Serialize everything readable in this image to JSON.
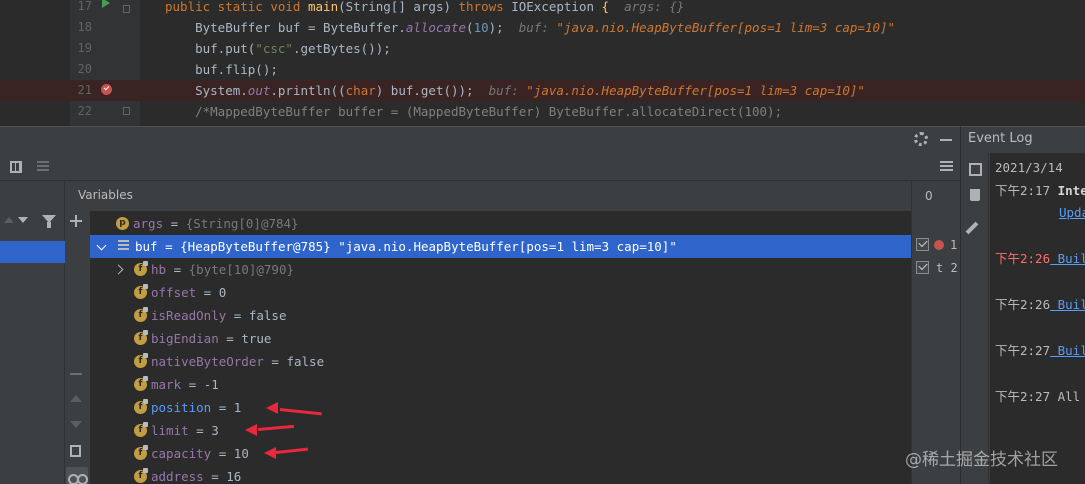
{
  "editor": {
    "lines": [
      {
        "num": "17",
        "parts": [
          {
            "t": "public static void ",
            "c": "kw"
          },
          {
            "t": "main",
            "c": "fn"
          },
          {
            "t": "(String[] args) ",
            "c": ""
          },
          {
            "t": "throws ",
            "c": "kw"
          },
          {
            "t": "IOException ",
            "c": ""
          },
          {
            "t": "{",
            "c": "fn"
          },
          {
            "t": "  args: {}",
            "c": "hint-lbl"
          }
        ]
      },
      {
        "num": "18",
        "parts": [
          {
            "t": "    ByteBuffer buf = ByteBuffer.",
            "c": ""
          },
          {
            "t": "allocate",
            "c": "field"
          },
          {
            "t": "(",
            "c": ""
          },
          {
            "t": "10",
            "c": "num"
          },
          {
            "t": ");  ",
            "c": ""
          },
          {
            "t": "buf: ",
            "c": "hint-lbl"
          },
          {
            "t": "\"java.nio.HeapByteBuffer[pos=1 lim=3 cap=10]\"",
            "c": "hint-val"
          }
        ]
      },
      {
        "num": "19",
        "parts": [
          {
            "t": "    buf.put(",
            "c": ""
          },
          {
            "t": "\"csc\"",
            "c": "str"
          },
          {
            "t": ".getBytes());",
            "c": ""
          }
        ]
      },
      {
        "num": "20",
        "parts": [
          {
            "t": "    buf.flip();",
            "c": ""
          }
        ]
      },
      {
        "num": "21",
        "parts": [
          {
            "t": "    System.",
            "c": ""
          },
          {
            "t": "out",
            "c": "field"
          },
          {
            "t": ".println((",
            "c": ""
          },
          {
            "t": "char",
            "c": "kw"
          },
          {
            "t": ") buf.get());  ",
            "c": ""
          },
          {
            "t": "buf: ",
            "c": "hint-lbl"
          },
          {
            "t": "\"java.nio.HeapByteBuffer[pos=1 lim=3 cap=10]\"",
            "c": "hint-val"
          }
        ]
      },
      {
        "num": "22",
        "parts": [
          {
            "t": "    /*MappedByteBuffer buffer = (MappedByteBuffer) ByteBuffer.allocateDirect(100);",
            "c": "cmt"
          }
        ]
      }
    ]
  },
  "debugger": {
    "variables_title": "Variables",
    "watch_count": "0",
    "rows": [
      {
        "badge": "p",
        "name": "args",
        "eq": " = ",
        "type": "{String[0]@784}",
        "value": "",
        "name_style": "vn",
        "indent": 1
      },
      {
        "badge": "obj",
        "name": "buf",
        "eq": " = ",
        "type": "{HeapByteBuffer@785} ",
        "value": "\"java.nio.HeapByteBuffer[pos=1 lim=3 cap=10]\"",
        "name_style": "vn-plain",
        "indent": 0,
        "selected": true,
        "expanded": true
      },
      {
        "badge": "f",
        "name": "hb",
        "eq": " = ",
        "type": "{byte[10]@790}",
        "value": "",
        "name_style": "vn",
        "indent": 2,
        "collapsed": true
      },
      {
        "badge": "f",
        "name": "offset",
        "eq": " = ",
        "type": "",
        "value": "0",
        "name_style": "vn",
        "indent": 2
      },
      {
        "badge": "f",
        "name": "isReadOnly",
        "eq": " = ",
        "type": "",
        "value": "false",
        "name_style": "vn",
        "indent": 2
      },
      {
        "badge": "f",
        "name": "bigEndian",
        "eq": " = ",
        "type": "",
        "value": "true",
        "name_style": "vn",
        "indent": 2
      },
      {
        "badge": "f",
        "name": "nativeByteOrder",
        "eq": " = ",
        "type": "",
        "value": "false",
        "name_style": "vn",
        "indent": 2
      },
      {
        "badge": "f",
        "name": "mark",
        "eq": " = ",
        "type": "",
        "value": "-1",
        "name_style": "vn",
        "indent": 2
      },
      {
        "badge": "f",
        "name": "position",
        "eq": " = ",
        "type": "",
        "value": "1",
        "name_style": "vn-blue",
        "indent": 2
      },
      {
        "badge": "f",
        "name": "limit",
        "eq": " = ",
        "type": "",
        "value": "3",
        "name_style": "vn",
        "indent": 2
      },
      {
        "badge": "f",
        "name": "capacity",
        "eq": " = ",
        "type": "",
        "value": "10",
        "name_style": "vn",
        "indent": 2
      },
      {
        "badge": "f",
        "name": "address",
        "eq": " = ",
        "type": "",
        "value": "16",
        "name_style": "vn",
        "indent": 2
      }
    ],
    "watches": [
      {
        "label": "1",
        "dot": true
      },
      {
        "label": "t 2",
        "dot": false
      }
    ]
  },
  "event_log": {
    "title": "Event Log",
    "date": "2021/3/14",
    "entries": [
      {
        "time": "下午2:17",
        "text": "Inte",
        "style": "bold",
        "time_red": false,
        "sub_link": "Upda"
      },
      {
        "time": "下午2:26",
        "text": "Buil",
        "style": "link",
        "time_red": true
      },
      {
        "time": "下午2:26",
        "text": "Buil",
        "style": "link",
        "time_red": false
      },
      {
        "time": "下午2:27",
        "text": "Buil",
        "style": "link",
        "time_red": false
      },
      {
        "time": "下午2:27",
        "text": "All",
        "style": "plain",
        "time_red": false
      }
    ]
  },
  "watermark": "@稀土掘金技术社区",
  "colors": {
    "selection": "#2f65ca",
    "annotation_arrow": "#e8283c",
    "breakpoint": "#c75450"
  }
}
